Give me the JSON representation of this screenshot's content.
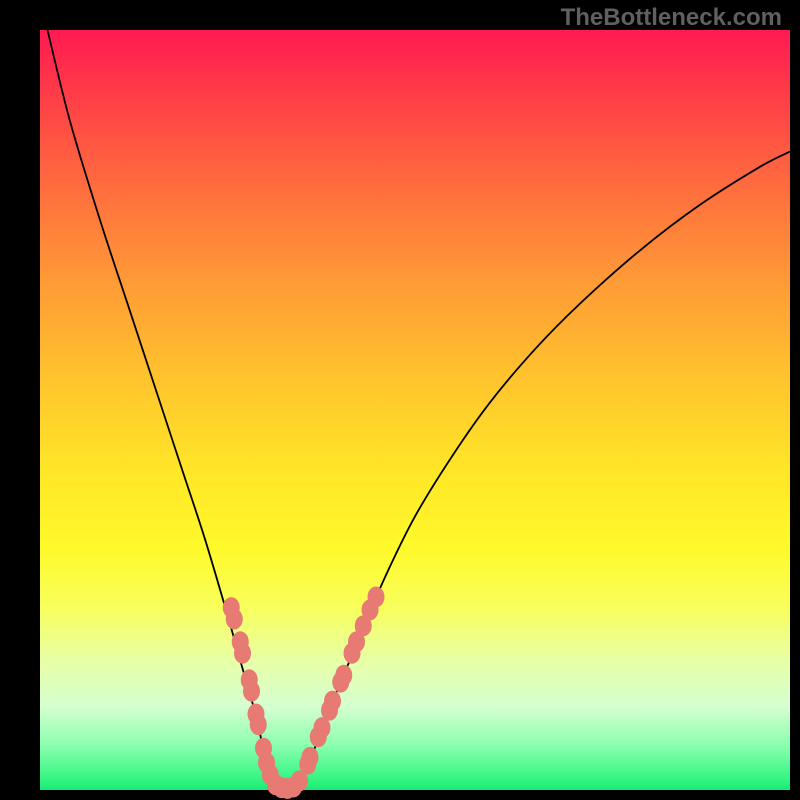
{
  "watermark_text": "TheBottleneck.com",
  "chart_data": {
    "type": "line",
    "title": "",
    "xlabel": "",
    "ylabel": "",
    "xlim": [
      0,
      100
    ],
    "ylim": [
      0,
      100
    ],
    "series": [
      {
        "name": "bottleneck-curve",
        "x": [
          1,
          4,
          8,
          12,
          16,
          19,
          22,
          25,
          27,
          29,
          30,
          31,
          32,
          33,
          34.5,
          36,
          38,
          40,
          43,
          46,
          50,
          55,
          60,
          66,
          72,
          80,
          88,
          96,
          100
        ],
        "y": [
          100,
          88,
          75,
          63,
          51,
          42,
          33,
          23,
          16,
          9,
          4,
          1,
          0,
          0,
          1,
          4,
          9,
          14,
          21,
          28,
          36,
          44,
          51,
          58,
          64,
          71,
          77,
          82,
          84
        ]
      }
    ],
    "beads": {
      "name": "dotted-overlay",
      "points": [
        {
          "x": 25.5,
          "y": 24.0
        },
        {
          "x": 25.9,
          "y": 22.5
        },
        {
          "x": 26.7,
          "y": 19.5
        },
        {
          "x": 27.0,
          "y": 18.0
        },
        {
          "x": 27.9,
          "y": 14.5
        },
        {
          "x": 28.2,
          "y": 13.0
        },
        {
          "x": 28.8,
          "y": 10.0
        },
        {
          "x": 29.1,
          "y": 8.6
        },
        {
          "x": 29.8,
          "y": 5.5
        },
        {
          "x": 30.2,
          "y": 3.6
        },
        {
          "x": 30.7,
          "y": 2.0
        },
        {
          "x": 31.4,
          "y": 0.7
        },
        {
          "x": 32.2,
          "y": 0.3
        },
        {
          "x": 33.0,
          "y": 0.2
        },
        {
          "x": 33.8,
          "y": 0.4
        },
        {
          "x": 34.6,
          "y": 1.2
        },
        {
          "x": 35.7,
          "y": 3.4
        },
        {
          "x": 36.0,
          "y": 4.3
        },
        {
          "x": 37.1,
          "y": 7.0
        },
        {
          "x": 37.6,
          "y": 8.2
        },
        {
          "x": 38.6,
          "y": 10.5
        },
        {
          "x": 39.0,
          "y": 11.7
        },
        {
          "x": 40.1,
          "y": 14.2
        },
        {
          "x": 40.5,
          "y": 15.1
        },
        {
          "x": 41.6,
          "y": 18.0
        },
        {
          "x": 42.2,
          "y": 19.5
        },
        {
          "x": 43.1,
          "y": 21.6
        },
        {
          "x": 44.0,
          "y": 23.7
        },
        {
          "x": 44.8,
          "y": 25.4
        }
      ]
    }
  }
}
